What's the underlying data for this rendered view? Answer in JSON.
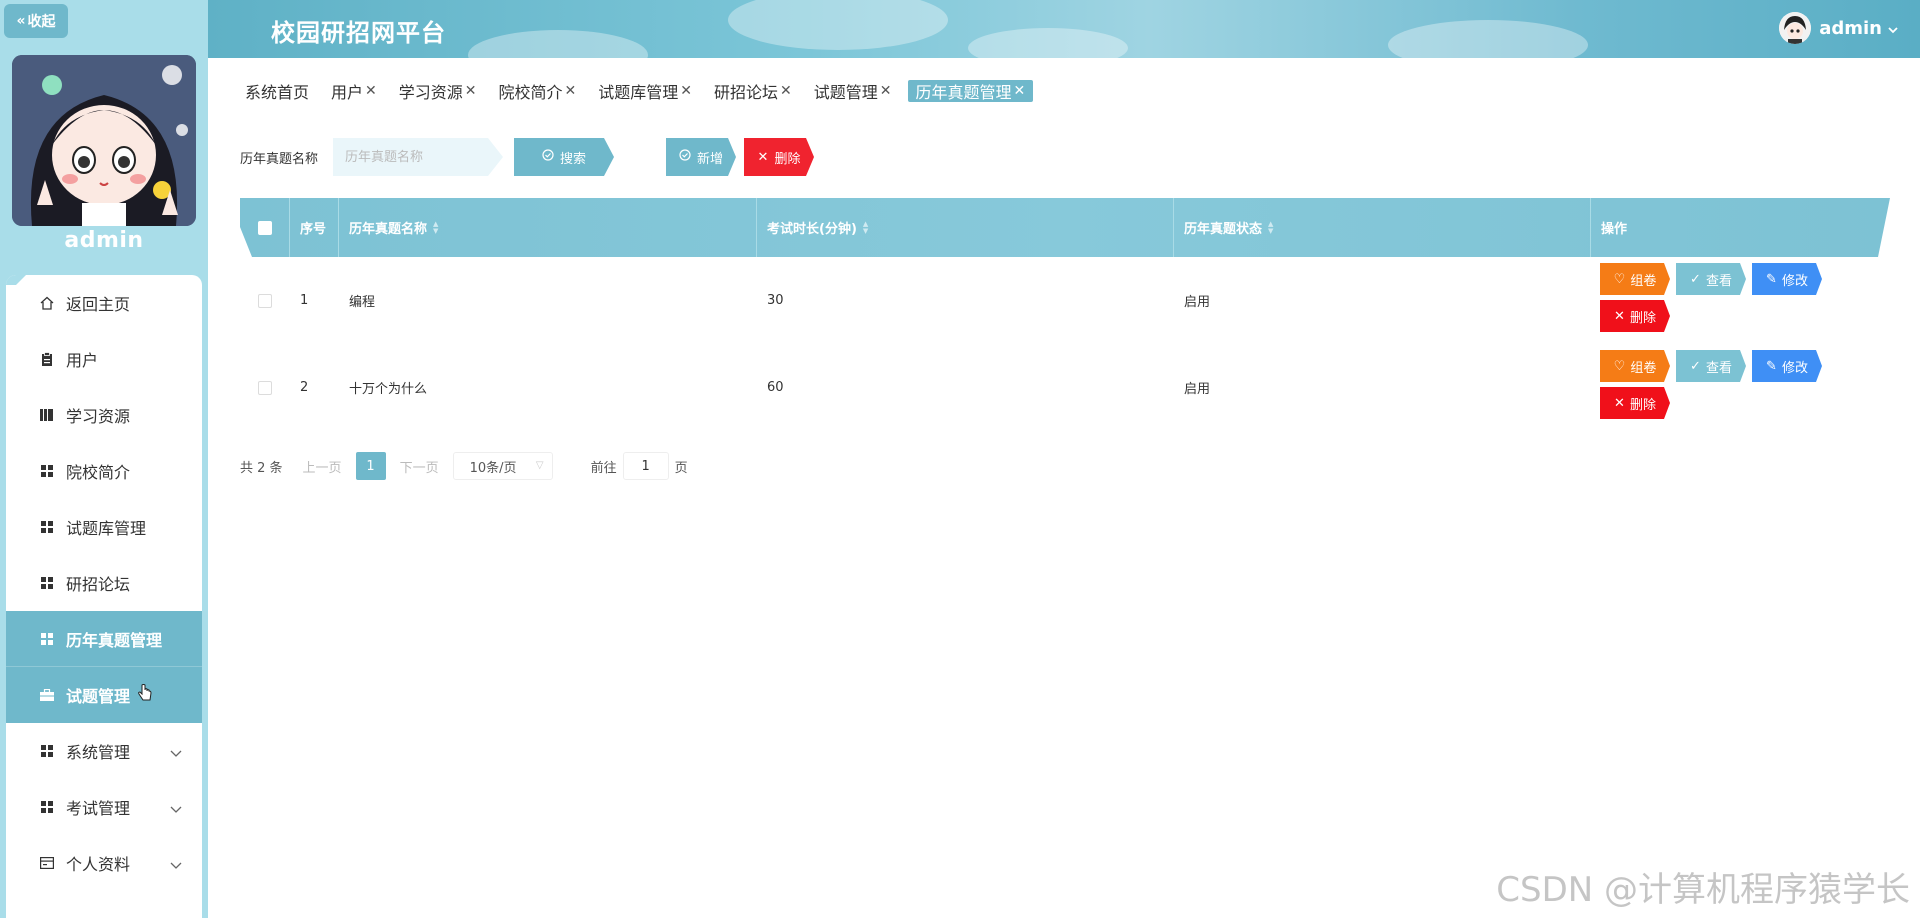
{
  "app": {
    "title": "校园研招网平台",
    "user": "admin"
  },
  "sidebar": {
    "collapse_label": "收起",
    "username": "admin",
    "items": [
      {
        "label": "返回主页",
        "icon": "home-icon"
      },
      {
        "label": "用户",
        "icon": "clipboard-icon"
      },
      {
        "label": "学习资源",
        "icon": "book-icon"
      },
      {
        "label": "院校简介",
        "icon": "grid-icon"
      },
      {
        "label": "试题库管理",
        "icon": "grid-icon"
      },
      {
        "label": "研招论坛",
        "icon": "grid-icon"
      },
      {
        "label": "历年真题管理",
        "icon": "grid-icon",
        "active": true
      },
      {
        "label": "试题管理",
        "icon": "briefcase-icon",
        "active": true
      },
      {
        "label": "系统管理",
        "icon": "grid-icon",
        "expandable": true
      },
      {
        "label": "考试管理",
        "icon": "grid-icon",
        "expandable": true
      },
      {
        "label": "个人资料",
        "icon": "card-icon",
        "expandable": true
      }
    ]
  },
  "tabs": [
    {
      "label": "系统首页",
      "closable": false
    },
    {
      "label": "用户",
      "closable": true
    },
    {
      "label": "学习资源",
      "closable": true
    },
    {
      "label": "院校简介",
      "closable": true
    },
    {
      "label": "试题库管理",
      "closable": true
    },
    {
      "label": "研招论坛",
      "closable": true
    },
    {
      "label": "试题管理",
      "closable": true
    },
    {
      "label": "历年真题管理",
      "closable": true,
      "active": true
    }
  ],
  "search": {
    "label": "历年真题名称",
    "placeholder": "历年真题名称",
    "search_btn": "搜索",
    "add_btn": "新增",
    "delete_btn": "删除"
  },
  "table": {
    "headers": [
      "序号",
      "历年真题名称",
      "考试时长(分钟)",
      "历年真题状态",
      "操作"
    ],
    "rows": [
      {
        "index": "1",
        "name": "编程",
        "duration": "30",
        "status": "启用"
      },
      {
        "index": "2",
        "name": "十万个为什么",
        "duration": "60",
        "status": "启用"
      }
    ],
    "row_actions": {
      "compose": "组卷",
      "view": "查看",
      "edit": "修改",
      "delete": "删除"
    }
  },
  "pagination": {
    "total": "共 2 条",
    "prev": "上一页",
    "current": "1",
    "next": "下一页",
    "page_size": "10条/页",
    "goto_prefix": "前往",
    "goto_value": "1",
    "goto_suffix": "页"
  },
  "watermark": "CSDN @计算机程序猿学长",
  "colors": {
    "primary": "#6fb8cb",
    "danger": "#f0232f",
    "warning": "#f57c16",
    "info": "#3f8ff5",
    "sidebar_bg": "#a9dde9"
  }
}
